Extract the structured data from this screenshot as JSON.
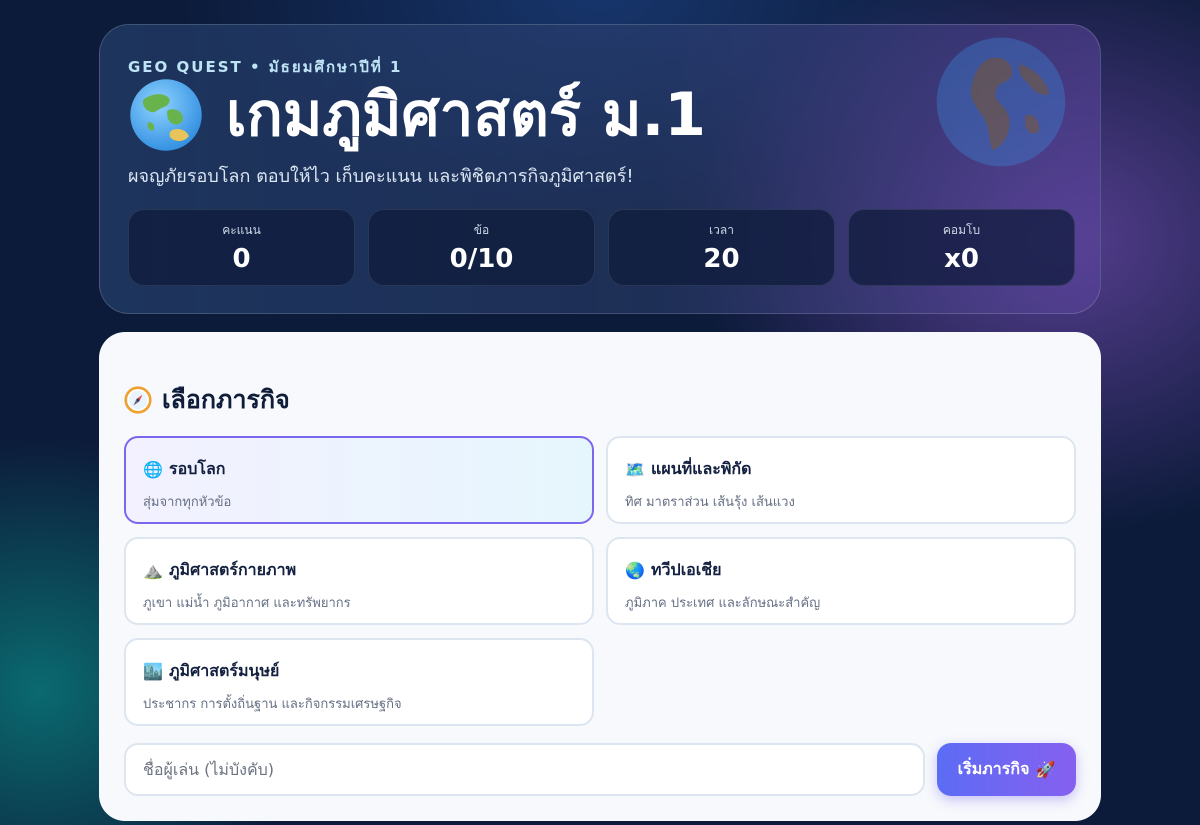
{
  "header": {
    "eyebrow": "GEO QUEST • มัธยมศึกษาปีที่ 1",
    "title": "เกมภูมิศาสตร์ ม.1",
    "subtitle": "ผจญภัยรอบโลก ตอบให้ไว เก็บคะแนน และพิชิตภารกิจภูมิศาสตร์!",
    "icon": "globe-icon"
  },
  "stats": [
    {
      "label": "คะแนน",
      "value": "0"
    },
    {
      "label": "ข้อ",
      "value": "0/10"
    },
    {
      "label": "เวลา",
      "value": "20"
    },
    {
      "label": "คอมโบ",
      "value": "x0"
    }
  ],
  "missions_section": {
    "title": "เลือกภารกิจ",
    "icon": "compass-icon"
  },
  "missions": [
    {
      "icon": "🌐",
      "title": "รอบโลก",
      "desc": "สุ่มจากทุกหัวข้อ",
      "selected": true
    },
    {
      "icon": "🗺️",
      "title": "แผนที่และพิกัด",
      "desc": "ทิศ มาตราส่วน เส้นรุ้ง เส้นแวง",
      "selected": false
    },
    {
      "icon": "⛰️",
      "title": "ภูมิศาสตร์กายภาพ",
      "desc": "ภูเขา แม่น้ำ ภูมิอากาศ และทรัพยากร",
      "selected": false
    },
    {
      "icon": "🌏",
      "title": "ทวีปเอเชีย",
      "desc": "ภูมิภาค ประเทศ และลักษณะสำคัญ",
      "selected": false
    },
    {
      "icon": "🏙️",
      "title": "ภูมิศาสตร์มนุษย์",
      "desc": "ประชากร การตั้งถิ่นฐาน และกิจกรรมเศรษฐกิจ",
      "selected": false
    }
  ],
  "player": {
    "placeholder": "ชื่อผู้เล่น (ไม่บังคับ)",
    "value": ""
  },
  "start_button": {
    "label": "เริ่มภารกิจ",
    "icon": "🚀"
  },
  "colors": {
    "accent": "#7a67ec",
    "button_start": "#5c6cf5",
    "button_end": "#8660ef",
    "panel": "#f7f9fc"
  }
}
